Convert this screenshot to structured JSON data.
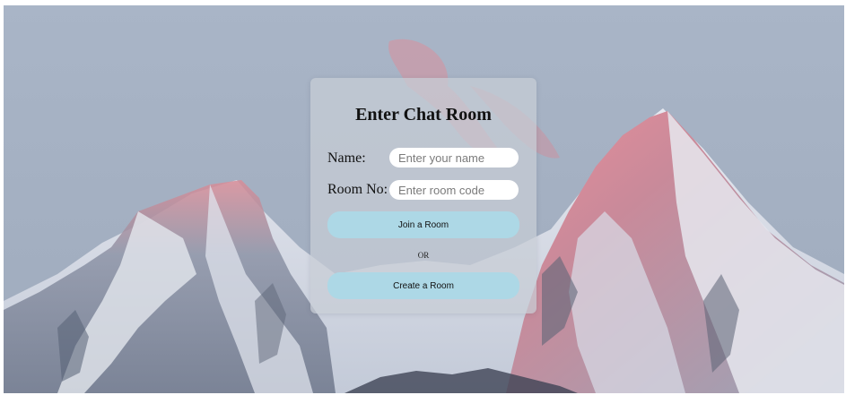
{
  "form": {
    "title": "Enter Chat Room",
    "name_label": "Name:",
    "name_placeholder": "Enter your name",
    "name_value": "",
    "room_label": "Room No:",
    "room_placeholder": "Enter room code",
    "room_value": "",
    "join_button_label": "Join a Room",
    "or_text": "OR",
    "create_button_label": "Create a Room"
  },
  "colors": {
    "button_background": "#add8e6",
    "card_background": "#c8cdd6",
    "input_background": "#ffffff"
  }
}
